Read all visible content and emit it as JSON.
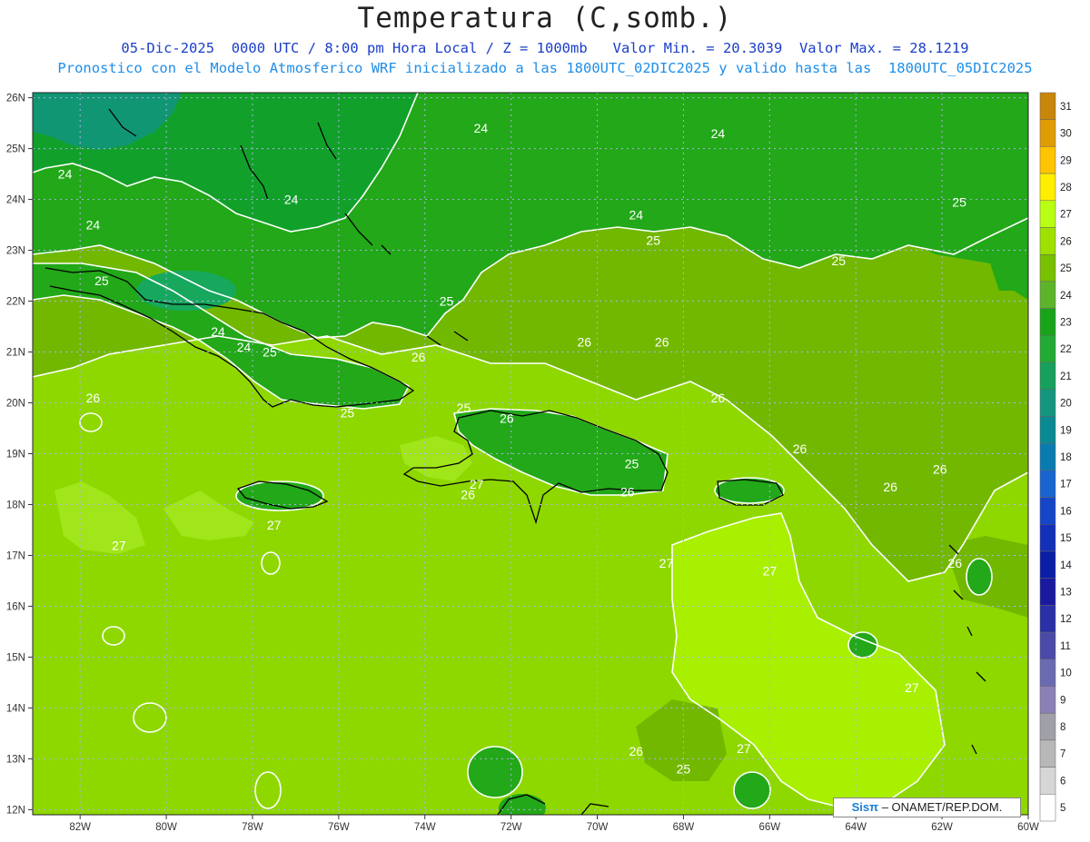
{
  "title": "Temperatura (C,somb.)",
  "subtitle1": "05-Dic-2025  0000 UTC / 8:00 pm Hora Local / Z = 1000mb   Valor Min. = 20.3039  Valor Max. = 28.1219",
  "subtitle2": "Pronostico con el Modelo Atmosferico WRF inicializado a las 1800UTC_02DIC2025 y valido hasta las  1800UTC_05DIC2025",
  "credit": {
    "brand": "Sisπ",
    "text": " – ONAMET/REP.DOM."
  },
  "lat_labels": [
    "26N",
    "25N",
    "24N",
    "23N",
    "22N",
    "21N",
    "20N",
    "19N",
    "18N",
    "17N",
    "16N",
    "15N",
    "14N",
    "13N",
    "12N"
  ],
  "lon_labels": [
    "82W",
    "80W",
    "78W",
    "76W",
    "74W",
    "72W",
    "70W",
    "68W",
    "66W",
    "64W",
    "62W",
    "60W"
  ],
  "colorbar": {
    "levels": [
      "31",
      "30",
      "29",
      "28",
      "27",
      "26",
      "25",
      "24",
      "23",
      "22",
      "21",
      "20",
      "19",
      "18",
      "17",
      "16",
      "15",
      "14",
      "13",
      "12",
      "11",
      "10",
      "9",
      "8",
      "7",
      "6",
      "5"
    ],
    "colors": [
      "#c8860a",
      "#e09c05",
      "#ffc400",
      "#ffee00",
      "#b8ff14",
      "#a0e000",
      "#78c000",
      "#5db42a",
      "#19a319",
      "#22aa35",
      "#16a05c",
      "#14967e",
      "#0a8a92",
      "#0a7bb0",
      "#1865d0",
      "#1546c8",
      "#1230b8",
      "#0a1ea6",
      "#1a1aa0",
      "#2a30a6",
      "#4a4aa8",
      "#6a6ab0",
      "#8c80b6",
      "#a0a0a8",
      "#b8b8b8",
      "#d6d6d6",
      "#ffffff"
    ]
  },
  "contour_labels": [
    {
      "t": "24",
      "lon": -82.35,
      "lat": 24.5
    },
    {
      "t": "24",
      "lon": -77.1,
      "lat": 24.0
    },
    {
      "t": "24",
      "lon": -81.7,
      "lat": 23.5
    },
    {
      "t": "25",
      "lon": -81.5,
      "lat": 22.4
    },
    {
      "t": "24",
      "lon": -78.8,
      "lat": 21.4
    },
    {
      "t": "24",
      "lon": -78.2,
      "lat": 21.1
    },
    {
      "t": "25",
      "lon": -77.6,
      "lat": 21.0
    },
    {
      "t": "25",
      "lon": -75.8,
      "lat": 19.8
    },
    {
      "t": "26",
      "lon": -81.7,
      "lat": 20.1
    },
    {
      "t": "26",
      "lon": -74.15,
      "lat": 20.9
    },
    {
      "t": "25",
      "lon": -73.5,
      "lat": 22.0
    },
    {
      "t": "24",
      "lon": -72.7,
      "lat": 25.4
    },
    {
      "t": "24",
      "lon": -67.2,
      "lat": 25.3
    },
    {
      "t": "24",
      "lon": -69.1,
      "lat": 23.7
    },
    {
      "t": "25",
      "lon": -68.7,
      "lat": 23.2
    },
    {
      "t": "25",
      "lon": -64.4,
      "lat": 22.8
    },
    {
      "t": "25",
      "lon": -61.6,
      "lat": 23.95
    },
    {
      "t": "26",
      "lon": -70.3,
      "lat": 21.2
    },
    {
      "t": "26",
      "lon": -68.5,
      "lat": 21.2
    },
    {
      "t": "26",
      "lon": -67.2,
      "lat": 20.1
    },
    {
      "t": "25",
      "lon": -73.1,
      "lat": 19.9
    },
    {
      "t": "26",
      "lon": -72.1,
      "lat": 19.7
    },
    {
      "t": "25",
      "lon": -69.2,
      "lat": 18.8
    },
    {
      "t": "26",
      "lon": -69.3,
      "lat": 18.25
    },
    {
      "t": "27",
      "lon": -72.8,
      "lat": 18.4
    },
    {
      "t": "26",
      "lon": -73.0,
      "lat": 18.2
    },
    {
      "t": "26",
      "lon": -65.3,
      "lat": 19.1
    },
    {
      "t": "26",
      "lon": -62.05,
      "lat": 18.7
    },
    {
      "t": "26",
      "lon": -63.2,
      "lat": 18.35
    },
    {
      "t": "27",
      "lon": -77.5,
      "lat": 17.6
    },
    {
      "t": "27",
      "lon": -81.1,
      "lat": 17.2
    },
    {
      "t": "27",
      "lon": -68.4,
      "lat": 16.85
    },
    {
      "t": "27",
      "lon": -66.0,
      "lat": 16.7
    },
    {
      "t": "26",
      "lon": -61.7,
      "lat": 16.85
    },
    {
      "t": "27",
      "lon": -62.7,
      "lat": 14.4
    },
    {
      "t": "26",
      "lon": -69.1,
      "lat": 13.15
    },
    {
      "t": "25",
      "lon": -68.0,
      "lat": 12.8
    },
    {
      "t": "27",
      "lon": -66.6,
      "lat": 13.2
    }
  ]
}
